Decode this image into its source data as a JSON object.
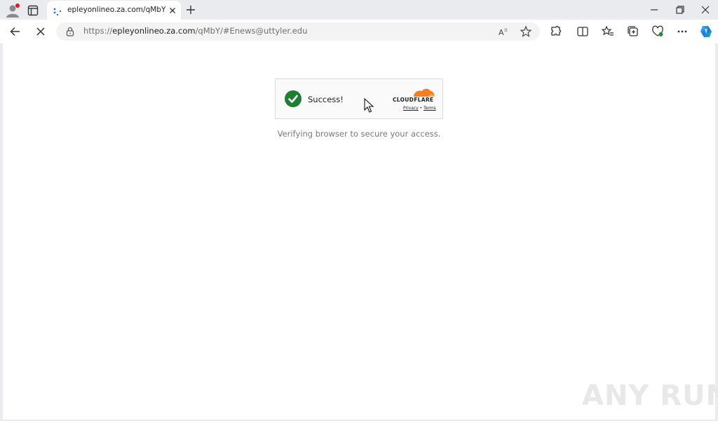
{
  "browser": {
    "tab": {
      "title": "epleyonlineo.za.com/qMbY/#Enews@uttyler.edu",
      "favicon": "loading-spinner-icon"
    },
    "address": {
      "scheme": "https://",
      "host": "epleyonlineo.za.com",
      "path": "/qMbY/#Enews@uttyler.edu"
    },
    "icons": [
      "profile-icon",
      "tab-actions-icon",
      "new-tab-icon",
      "minimize-icon",
      "restore-icon",
      "close-window-icon",
      "back-icon",
      "stop-loading-icon",
      "site-info-lock-icon",
      "read-aloud-icon",
      "favorite-star-icon",
      "extensions-icon",
      "split-screen-icon",
      "favorites-icon",
      "collections-icon",
      "browser-essentials-icon",
      "more-icon",
      "copilot-icon"
    ]
  },
  "page": {
    "widget": {
      "status": "Success!",
      "brand": "CLOUDFLARE",
      "privacy": "Privacy",
      "separator": "•",
      "terms": "Terms"
    },
    "message": "Verifying browser to secure your access.",
    "watermark": "ANY RUN"
  },
  "colors": {
    "success_green": "#1e7e34",
    "cloudflare_orange": "#f38020",
    "chrome_bg": "#e9ebee",
    "copilot_blue": "#1a73e8"
  }
}
